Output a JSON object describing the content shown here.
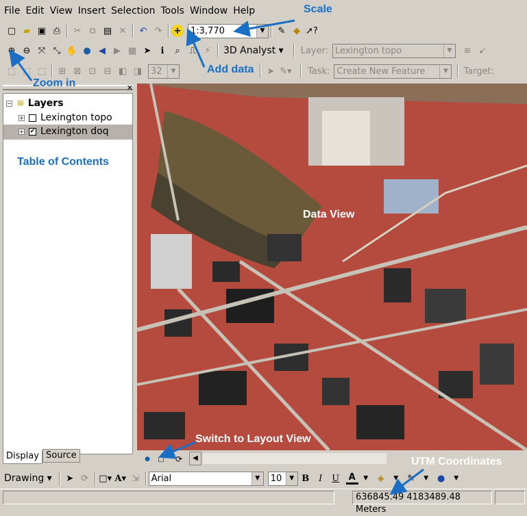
{
  "menu": [
    "File",
    "Edit",
    "View",
    "Insert",
    "Selection",
    "Tools",
    "Window",
    "Help"
  ],
  "scale_value": "1:3,770",
  "analyst_label": "3D Analyst",
  "layer_label": "Layer:",
  "layer_value": "Lexington topo",
  "task_label": "Task:",
  "task_value": "Create New Feature",
  "target_label": "Target:",
  "editor_size": "32",
  "toc": {
    "root": "Layers",
    "layers": [
      {
        "name": "Lexington topo",
        "checked": false
      },
      {
        "name": "Lexington doq",
        "checked": true
      }
    ],
    "tab_display": "Display",
    "tab_source": "Source"
  },
  "drawing": {
    "label": "Drawing",
    "font": "Arial",
    "size": "10",
    "bold": "B",
    "italic": "I",
    "underline": "U",
    "text_tool": "A"
  },
  "status": {
    "coords": "636845.49  4183489.48 Meters"
  },
  "callouts": {
    "scale": "Scale",
    "add_data": "Add data",
    "zoom_in": "Zoom in",
    "toc": "Table of Contents",
    "data_view": "Data View",
    "layout": "Switch to Layout View",
    "utm": "UTM Coordinates"
  },
  "colors": {
    "accent": "#1a6fc4",
    "map_red": "#b54a3e"
  }
}
